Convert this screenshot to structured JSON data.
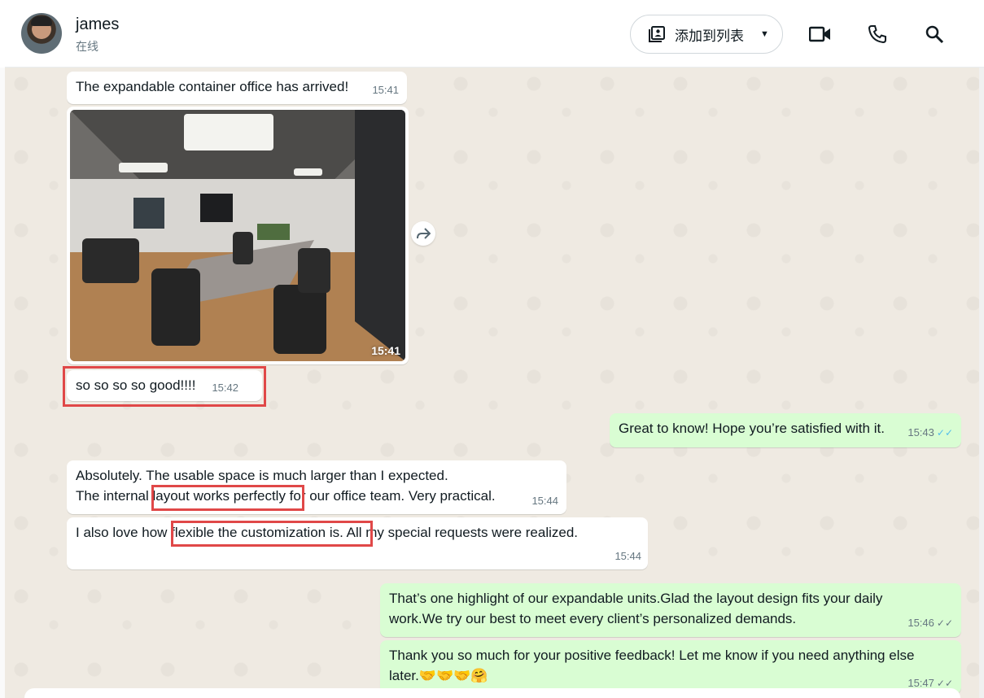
{
  "header": {
    "contact_name": "james",
    "status": "在线",
    "add_to_list_label": "添加到列表",
    "icons": [
      "video-call-icon",
      "voice-call-icon",
      "search-icon"
    ]
  },
  "messages": [
    {
      "id": "m1",
      "direction": "in",
      "text": "The expandable container office has arrived!",
      "time": "15:41"
    },
    {
      "id": "m2",
      "direction": "in",
      "type": "image",
      "time": "15:41"
    },
    {
      "id": "m3",
      "direction": "in",
      "text": "so so so so good!!!!",
      "time": "15:42"
    },
    {
      "id": "m4",
      "direction": "out",
      "text": "Great to know! Hope you’re satisfied with it.",
      "time": "15:43",
      "status": "read"
    },
    {
      "id": "m5",
      "direction": "in",
      "lines": [
        "Absolutely. The usable space is much larger than I expected.",
        "The internal layout works perfectly for our office team. Very practical."
      ],
      "time": "15:44"
    },
    {
      "id": "m6",
      "direction": "in",
      "text": "I also love how flexible the customization is. All my special requests were realized.",
      "time": "15:44"
    },
    {
      "id": "m7",
      "direction": "out",
      "lines": [
        "That’s one highlight of our expandable units.Glad the layout design fits your daily",
        "work.We try our best to meet every client’s personalized demands."
      ],
      "time": "15:46",
      "status": "delivered"
    },
    {
      "id": "m8",
      "direction": "out",
      "lines": [
        "Thank you so much for your positive feedback! Let me know if you need anything else",
        "later.🤝🤝🤝🤗"
      ],
      "time": "15:47",
      "status": "delivered"
    }
  ],
  "colors": {
    "incoming": "#ffffff",
    "outgoing": "#d9fdd3",
    "highlight": "#e04848",
    "read_ticks": "#53bdeb"
  }
}
